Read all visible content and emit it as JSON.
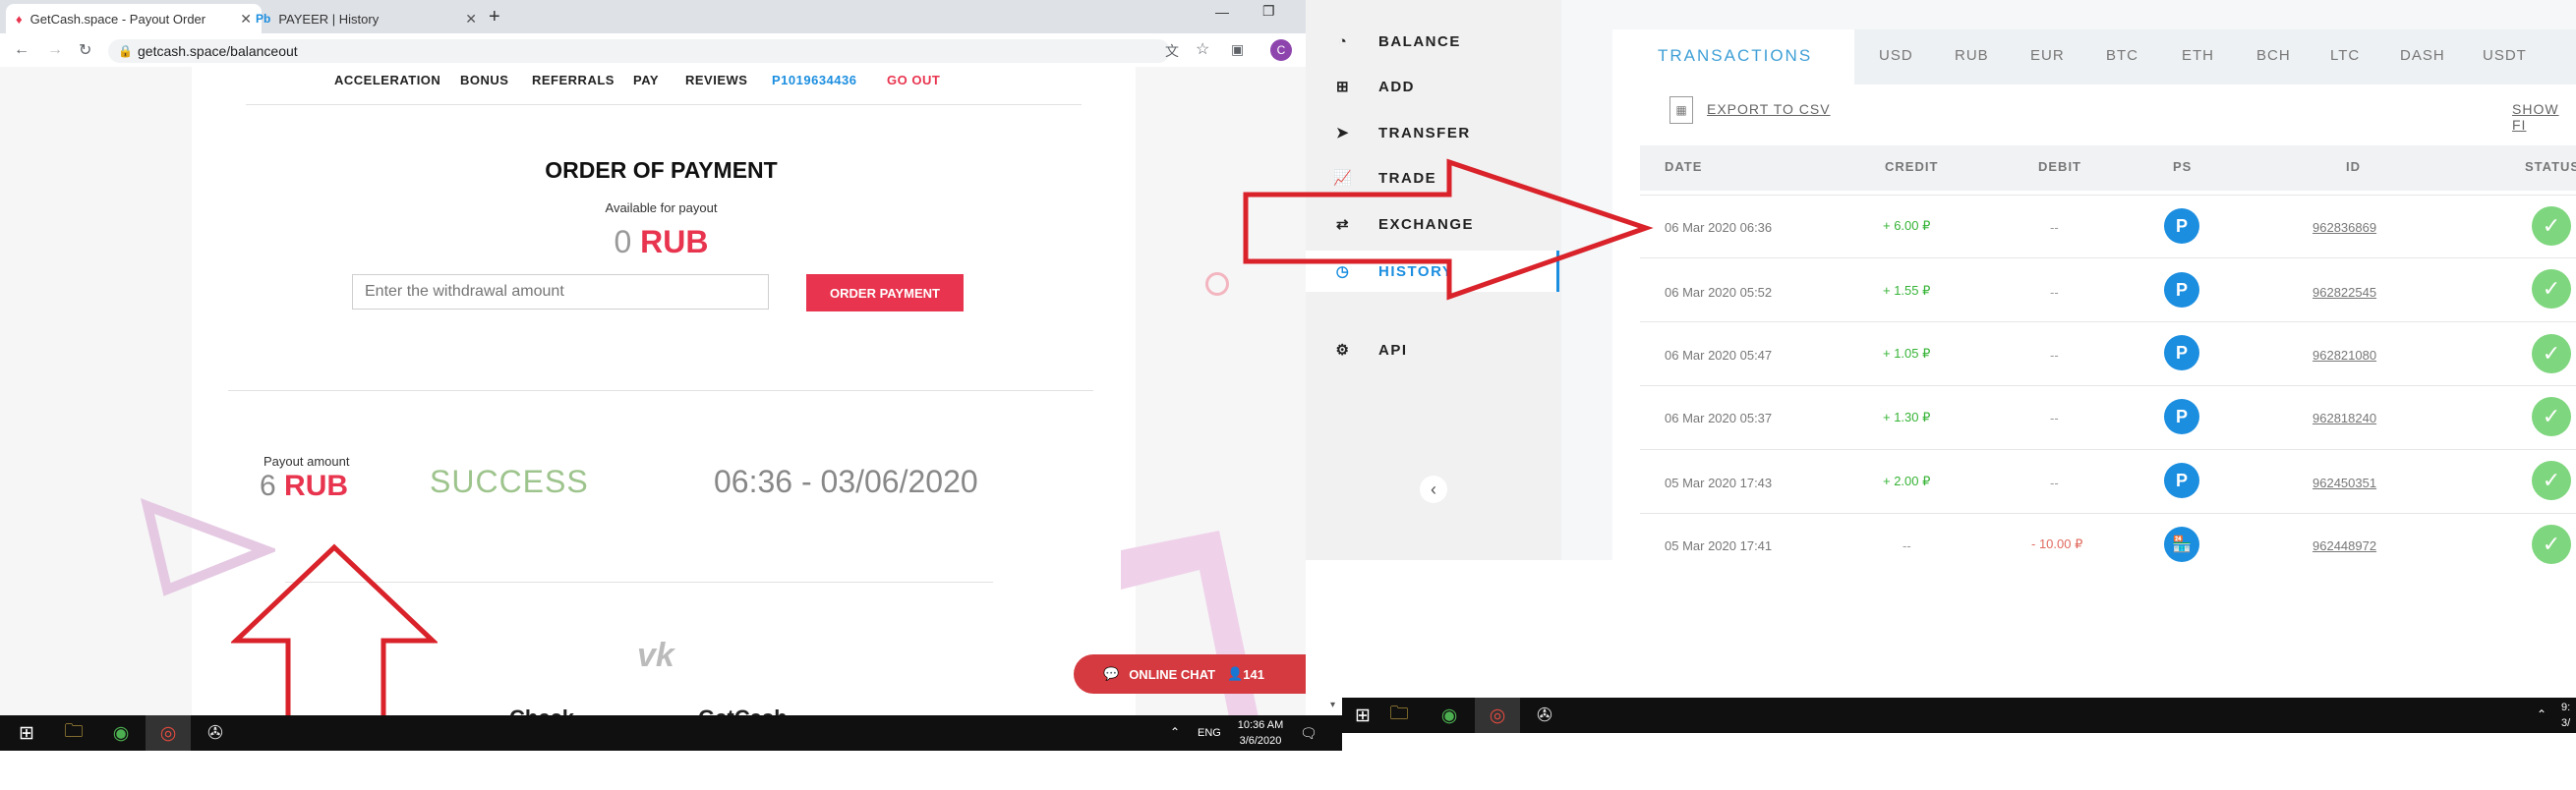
{
  "browser": {
    "tabs": [
      {
        "label": "GetCash.space - Payout Order"
      },
      {
        "label": "PAYEER | History"
      }
    ],
    "url": "getcash.space/balanceout",
    "new_tab": "+"
  },
  "site": {
    "nav": [
      {
        "label": "ACCELERATION"
      },
      {
        "label": "BONUS"
      },
      {
        "label": "REFERRALS"
      },
      {
        "label": "PAY"
      },
      {
        "label": "REVIEWS"
      },
      {
        "label": "P1019634436"
      },
      {
        "label": "GO OUT"
      }
    ],
    "order_title": "ORDER OF PAYMENT",
    "available_label": "Available for payout",
    "available_amount": "0",
    "currency": "RUB",
    "amount_placeholder": "Enter the withdrawal amount",
    "order_button": "ORDER PAYMENT",
    "payout_label": "Payout amount",
    "payout_amount": "6",
    "payout_currency": "RUB",
    "payout_status": "SUCCESS",
    "payout_time": "06:36 - 03/06/2020",
    "chat_label": "ONLINE CHAT",
    "chat_count": "141",
    "footer_partial": "Check",
    "footer_partial2": "GetCash"
  },
  "left_taskbar": {
    "lang": "ENG",
    "time": "10:36 AM",
    "date": "3/6/2020"
  },
  "payeer": {
    "sidebar": [
      {
        "label": "BALANCE",
        "icon": "speedometer-icon"
      },
      {
        "label": "ADD",
        "icon": "plus-square-icon"
      },
      {
        "label": "TRANSFER",
        "icon": "paper-plane-icon"
      },
      {
        "label": "TRADE",
        "icon": "chart-icon"
      },
      {
        "label": "EXCHANGE",
        "icon": "exchange-icon"
      },
      {
        "label": "HISTORY",
        "icon": "clock-icon"
      },
      {
        "label": "API",
        "icon": "gears-icon"
      }
    ],
    "collapse": "‹",
    "tabs": [
      "TRANSACTIONS",
      "USD",
      "RUB",
      "EUR",
      "BTC",
      "ETH",
      "BCH",
      "LTC",
      "DASH",
      "USDT"
    ],
    "export_label": "EXPORT TO CSV",
    "show_filter": "SHOW FI",
    "headers": {
      "date": "DATE",
      "credit": "CREDIT",
      "debit": "DEBIT",
      "ps": "PS",
      "id": "ID",
      "status": "STATUS"
    },
    "rows": [
      {
        "date": "06 Mar 2020 06:36",
        "credit": "+ 6.00 ₽",
        "debit": "--",
        "ps": "P",
        "id": "962836869"
      },
      {
        "date": "06 Mar 2020 05:52",
        "credit": "+ 1.55 ₽",
        "debit": "--",
        "ps": "P",
        "id": "962822545"
      },
      {
        "date": "06 Mar 2020 05:47",
        "credit": "+ 1.05 ₽",
        "debit": "--",
        "ps": "P",
        "id": "962821080"
      },
      {
        "date": "06 Mar 2020 05:37",
        "credit": "+ 1.30 ₽",
        "debit": "--",
        "ps": "P",
        "id": "962818240"
      },
      {
        "date": "05 Mar 2020 17:43",
        "credit": "+ 2.00 ₽",
        "debit": "--",
        "ps": "P",
        "id": "962450351"
      },
      {
        "date": "05 Mar 2020 17:41",
        "credit": "--",
        "debit": "- 10.00 ₽",
        "ps": "🏪",
        "id": "962448972"
      }
    ]
  },
  "right_taskbar": {
    "time_partial": "9:",
    "date_partial": "3/"
  },
  "colors": {
    "accent": "#e8344e",
    "payeer_blue": "#1b8ee0",
    "success_green": "#36b336",
    "arrow_red": "#d9222a"
  }
}
